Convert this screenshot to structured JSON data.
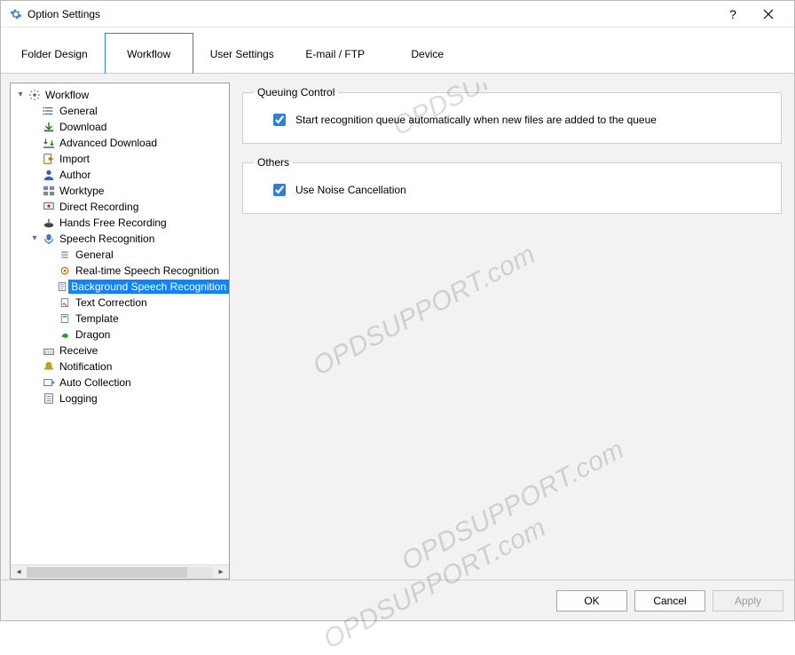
{
  "window": {
    "title": "Option Settings"
  },
  "tabs": [
    {
      "label": "Folder Design"
    },
    {
      "label": "Workflow"
    },
    {
      "label": "User Settings"
    },
    {
      "label": "E-mail / FTP"
    },
    {
      "label": "Device"
    }
  ],
  "tree": {
    "root": "Workflow",
    "items": [
      {
        "label": "General"
      },
      {
        "label": "Download"
      },
      {
        "label": "Advanced Download"
      },
      {
        "label": "Import"
      },
      {
        "label": "Author"
      },
      {
        "label": "Worktype"
      },
      {
        "label": "Direct Recording"
      },
      {
        "label": "Hands Free Recording"
      },
      {
        "label": "Speech Recognition"
      },
      {
        "label": "Receive"
      },
      {
        "label": "Notification"
      },
      {
        "label": "Auto Collection"
      },
      {
        "label": "Logging"
      }
    ],
    "speech_children": [
      {
        "label": "General"
      },
      {
        "label": "Real-time Speech Recognition"
      },
      {
        "label": "Background Speech Recognition"
      },
      {
        "label": "Text Correction"
      },
      {
        "label": "Template"
      },
      {
        "label": "Dragon"
      }
    ]
  },
  "panels": {
    "queuing": {
      "legend": "Queuing Control",
      "check1_label": "Start recognition queue automatically when new files are added to the queue"
    },
    "others": {
      "legend": "Others",
      "check1_label": "Use Noise Cancellation"
    }
  },
  "footer": {
    "ok": "OK",
    "cancel": "Cancel",
    "apply": "Apply"
  },
  "watermark": "OPDSUPPORT.com"
}
